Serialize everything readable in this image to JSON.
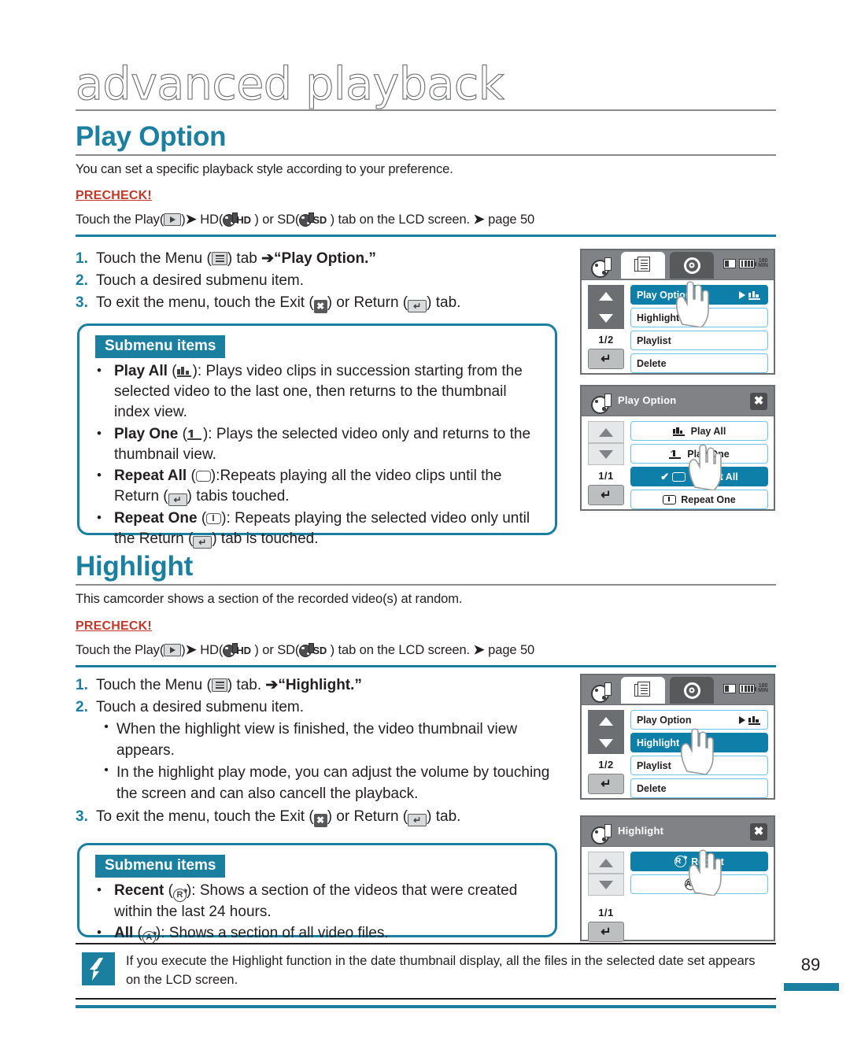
{
  "chapter": {
    "title": "advanced playback"
  },
  "page": {
    "number": "89"
  },
  "sections": [
    {
      "heading": "Play Option",
      "intro": "You can set a specific playback style according to your preference.",
      "precheck_label": "PRECHECK!",
      "precheck_parts": {
        "p1": "Touch the Play(",
        "p2": ")",
        "p3": " HD(",
        "hd": "HD",
        "p4": " ) or SD(",
        "sd": "SD",
        "p5": " ) tab on the LCD screen. ",
        "p6": " page 50"
      },
      "steps": [
        {
          "num": "1.",
          "pre": "Touch the Menu (",
          "mid": ") tab ",
          "arrow": "➔",
          "post": "“Play Option.”"
        },
        {
          "num": "2.",
          "text": "Touch a desired submenu item."
        },
        {
          "num": "3.",
          "pre": "To exit the menu, touch the Exit (",
          "mid": ") or Return (",
          "post": ") tab."
        }
      ],
      "submenu": {
        "title": "Submenu items",
        "items": [
          {
            "name": "Play All",
            "icon": "play-all-icon",
            "desc": "Plays video clips in succession starting from the selected video to the last one, then returns to the thumbnail index view."
          },
          {
            "name": "Play One",
            "icon": "play-one-icon",
            "desc": "Plays the selected video only and returns to the thumbnail view."
          },
          {
            "name": "Repeat All",
            "icon": "repeat-all-icon",
            "desc_a": "Repeats playing all the video clips until the Return (",
            "desc_b": ") tabis touched."
          },
          {
            "name": "Repeat One",
            "icon": "repeat-one-icon",
            "desc_a": " Repeats playing the selected video only until the Return (",
            "desc_b": ") tab is touched."
          }
        ]
      }
    },
    {
      "heading": "Highlight",
      "intro": "This camcorder shows a section of the recorded video(s) at random.",
      "precheck_label": "PRECHECK!",
      "precheck_parts": {
        "p1": "Touch the Play(",
        "p2": ")",
        "p3": " HD(",
        "hd": "HD",
        "p4": " ) or SD(",
        "sd": "SD",
        "p5": " ) tab on the LCD screen. ",
        "p6": " page 50"
      },
      "steps": [
        {
          "num": "1.",
          "pre": "Touch the Menu (",
          "mid": ") tab. ",
          "arrow": "➔",
          "post": "“Highlight.”"
        },
        {
          "num": "2.",
          "text": "Touch a desired submenu item."
        },
        {
          "num": "3.",
          "pre": "To exit the menu, touch the Exit (",
          "mid": ") or Return (",
          "post": ") tab."
        }
      ],
      "step2_bullets": [
        "When the highlight view is finished, the video thumbnail view appears.",
        "In the highlight play mode, you can adjust the volume by touching the screen and can also cancell the playback."
      ],
      "submenu": {
        "title": "Submenu items",
        "items": [
          {
            "name": "Recent",
            "icon": "recent-icon",
            "desc": "Shows a section of the videos that were created within the last 24 hours."
          },
          {
            "name": "All",
            "icon": "all-icon",
            "desc": "Shows a section of all video files."
          }
        ]
      }
    }
  ],
  "lcd_screens": [
    {
      "id": "play-option-menu",
      "type": "tabbed",
      "tabs": [
        "reel-tab",
        "menu-tab",
        "gear-tab"
      ],
      "status": {
        "card": "sd-card-icon",
        "battery": "battery-icon",
        "time": "180",
        "time_unit": "MIN"
      },
      "page_indicator": "1/2",
      "rows": [
        {
          "label": "Play Option",
          "selected": true,
          "has_arrow": true,
          "right_icon": "play-all-icon"
        },
        {
          "label": "Highlight",
          "selected": false
        },
        {
          "label": "Playlist",
          "selected": false
        },
        {
          "label": "Delete",
          "selected": false
        }
      ]
    },
    {
      "id": "play-option-submenu",
      "type": "titled",
      "title": "Play Option",
      "page_indicator": "1/1",
      "rows": [
        {
          "label": "Play All",
          "icon": "play-all-icon",
          "selected": false,
          "checked": false
        },
        {
          "label": "Play One",
          "icon": "play-one-icon",
          "selected": false,
          "checked": false
        },
        {
          "label": "Repeat All",
          "icon": "repeat-all-icon",
          "selected": true,
          "checked": true
        },
        {
          "label": "Repeat One",
          "icon": "repeat-one-icon",
          "selected": false,
          "checked": false
        }
      ]
    },
    {
      "id": "highlight-menu",
      "type": "tabbed",
      "tabs": [
        "reel-tab",
        "menu-tab",
        "gear-tab"
      ],
      "status": {
        "card": "sd-card-icon",
        "battery": "battery-icon",
        "time": "180",
        "time_unit": "MIN"
      },
      "page_indicator": "1/2",
      "rows": [
        {
          "label": "Play Option",
          "selected": false,
          "has_arrow": true,
          "right_icon": "play-all-icon"
        },
        {
          "label": "Highlight",
          "selected": true
        },
        {
          "label": "Playlist",
          "selected": false
        },
        {
          "label": "Delete",
          "selected": false
        }
      ]
    },
    {
      "id": "highlight-submenu",
      "type": "titled",
      "title": "Highlight",
      "page_indicator": "1/1",
      "rows": [
        {
          "label": "Recent",
          "icon": "recent-icon",
          "selected": true,
          "checked": false
        },
        {
          "label": "All",
          "icon": "all-icon",
          "selected": false,
          "checked": false
        }
      ]
    }
  ],
  "note": {
    "icon": "note-pen-icon",
    "text": "If you execute the Highlight function in the date thumbnail display, all the files in the selected date set appears on the LCD screen."
  },
  "colors": {
    "accent": "#1b7fa0",
    "selected_row": "#0e7fa8",
    "row_border": "#6bc5e8",
    "precheck": "#c0392b"
  }
}
